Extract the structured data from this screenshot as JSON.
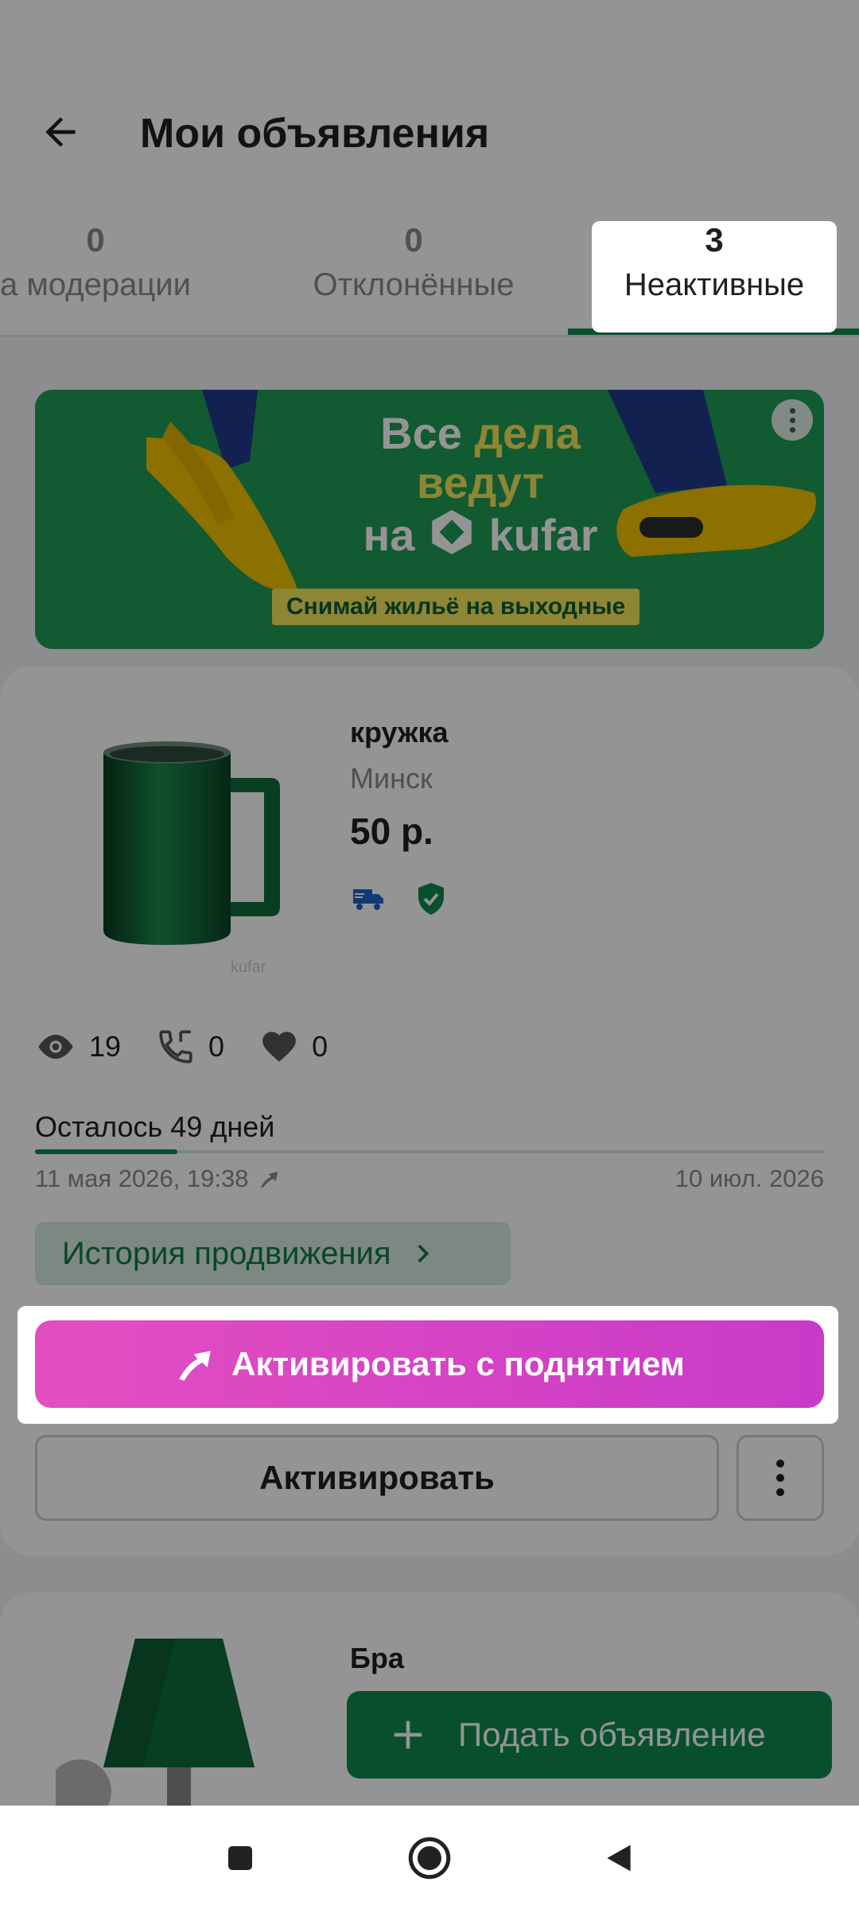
{
  "header": {
    "title": "Мои объявления",
    "back_icon": "arrow-left-icon"
  },
  "tabs": [
    {
      "count": "0",
      "label": "а модерации"
    },
    {
      "count": "0",
      "label": "Отклонённые"
    },
    {
      "count": "3",
      "label": "Неактивные",
      "active": true
    }
  ],
  "banner": {
    "line1_a": "Все",
    "line1_b": "дела",
    "line2": "ведут",
    "line3_a": "на",
    "line3_b": "kufar",
    "subtitle": "Снимай жильё на выходные",
    "colors": {
      "background": "#1f9b57",
      "accent": "#f5e75a"
    }
  },
  "listing": {
    "title": "кружка",
    "city": "Минск",
    "price": "50 р.",
    "badges": [
      "delivery-truck-icon",
      "verified-shield-icon"
    ],
    "views": "19",
    "calls": "0",
    "favorites": "0",
    "remaining": "Осталось 49 дней",
    "remaining_fraction": 0.18,
    "start_date": "11 мая 2026, 19:38",
    "end_date": "10 июл. 2026",
    "history_button": "История продвижения",
    "boost_button": "Активировать с поднятием",
    "activate_button": "Активировать"
  },
  "listing2": {
    "title": "Бра"
  },
  "fab": {
    "label": "Подать объявление"
  },
  "colors": {
    "brand_green": "#0f8b4f",
    "boost_start": "#e34fc0",
    "boost_end": "#c93ac8"
  }
}
